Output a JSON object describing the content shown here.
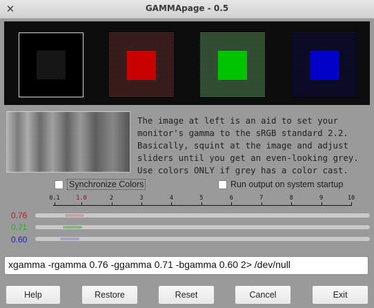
{
  "window": {
    "title": "GAMMApage - 0.5",
    "close_glyph": "✕"
  },
  "swatches": [
    {
      "name": "grey",
      "color": "#161616"
    },
    {
      "name": "red",
      "color": "#c80000"
    },
    {
      "name": "green",
      "color": "#00c300"
    },
    {
      "name": "blue",
      "color": "#0000c8"
    }
  ],
  "info_text": "The image at left is an aid to set your\nmonitor's gamma to the sRGB standard 2.2.\nBasically, squint at the image and adjust\nsliders until you get an even-looking grey.\nUse colors ONLY if grey has a color cast.",
  "checkboxes": {
    "sync": {
      "label": "Synchronize Colors",
      "checked": false
    },
    "run_startup": {
      "label": "Run output on system startup",
      "checked": false
    }
  },
  "scale": {
    "min": 0.1,
    "max": 10,
    "ticks": [
      "0.1",
      "1.0",
      "2",
      "3",
      "4",
      "5",
      "6",
      "7",
      "8",
      "9",
      "10"
    ],
    "tick_values": [
      0.1,
      1.0,
      2,
      3,
      4,
      5,
      6,
      7,
      8,
      9,
      10
    ]
  },
  "gamma": {
    "red": {
      "label": "0.76",
      "value": 0.76,
      "color": "#dd1111"
    },
    "green": {
      "label": "0.71",
      "value": 0.71,
      "color": "#1fb51f"
    },
    "blue": {
      "label": "0.60",
      "value": 0.6,
      "color": "#1a1ad6"
    }
  },
  "command": "xgamma -rgamma 0.76 -ggamma 0.71 -bgamma 0.60 2> /dev/null",
  "buttons": {
    "help": "Help",
    "restore": "Restore",
    "reset": "Reset",
    "cancel": "Cancel",
    "exit": "Exit"
  }
}
